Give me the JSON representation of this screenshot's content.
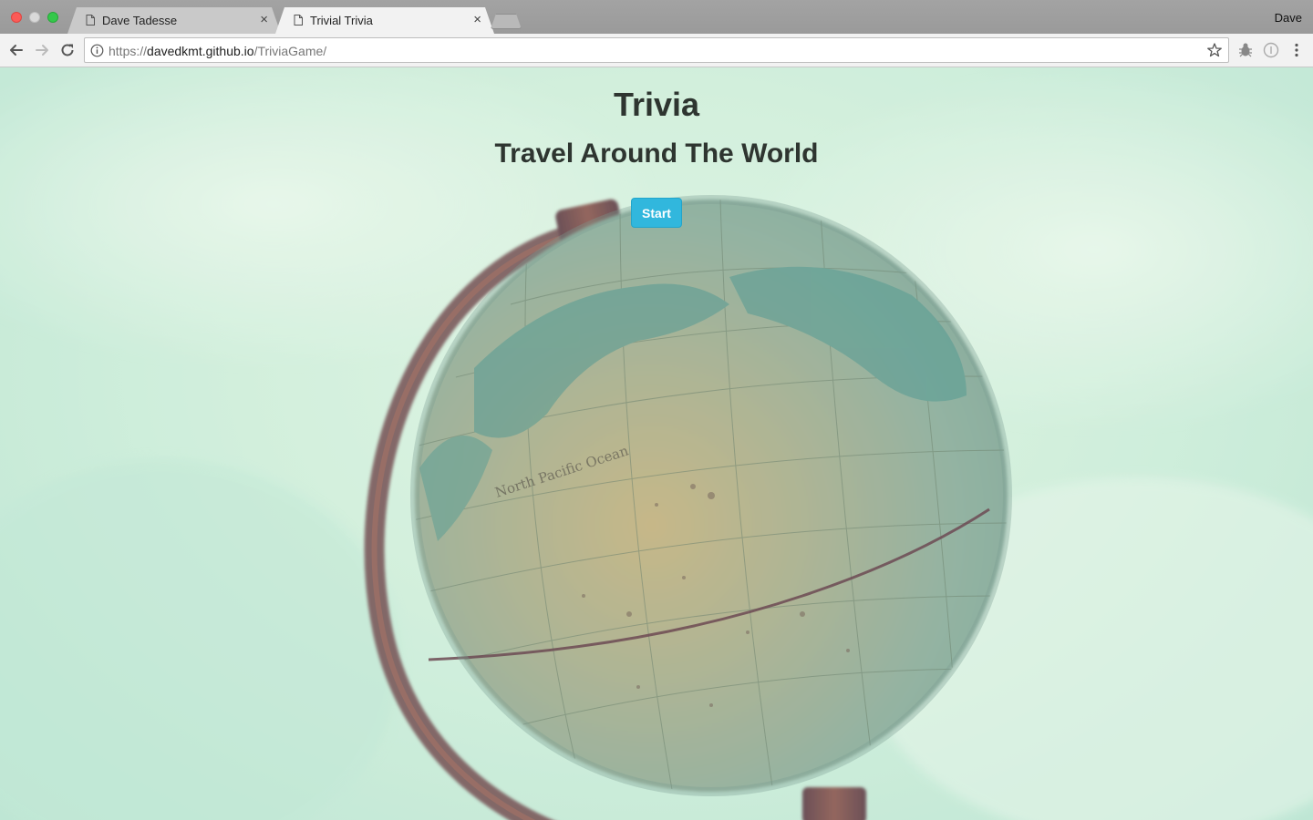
{
  "browser": {
    "tabs": [
      {
        "title": "Dave Tadesse",
        "active": false
      },
      {
        "title": "Trivial Trivia",
        "active": true
      }
    ],
    "profile_name": "Dave",
    "url_scheme": "https://",
    "url_host": "davedkmt.github.io",
    "url_path": "/TriviaGame/",
    "tab_close_glyph": "×"
  },
  "page": {
    "title": "Trivia",
    "subtitle": "Travel Around The World",
    "start_button_label": "Start",
    "accent_color": "#31b7dd",
    "background_image": "globe-photo"
  },
  "icons": [
    "back-arrow-icon",
    "forward-arrow-icon",
    "reload-icon",
    "info-icon",
    "star-icon",
    "extension-bug-icon",
    "extension-circle-icon",
    "menu-dots-icon",
    "document-icon"
  ]
}
